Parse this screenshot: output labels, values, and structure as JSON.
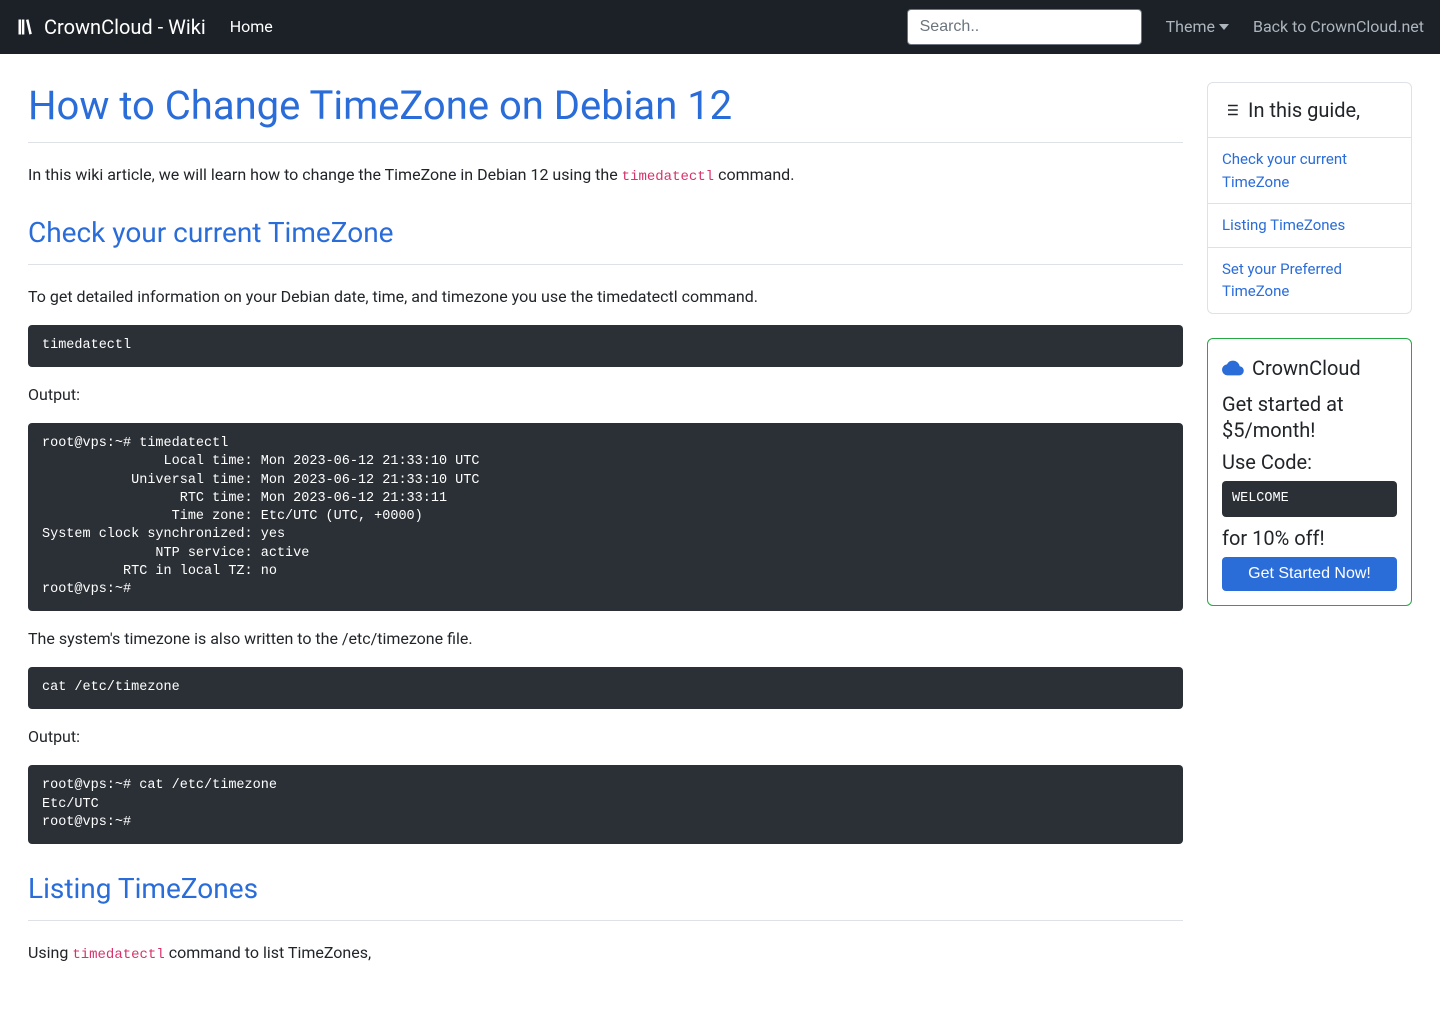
{
  "nav": {
    "brand": "CrownCloud - Wiki",
    "home": "Home",
    "search_placeholder": "Search..",
    "theme": "Theme",
    "back_link": "Back to CrownCloud.net"
  },
  "page": {
    "title": "How to Change TimeZone on Debian 12",
    "intro_before": "In this wiki article, we will learn how to change the TimeZone in Debian 12 using the ",
    "intro_code": "timedatectl",
    "intro_after": " command.",
    "section1_title": "Check your current TimeZone",
    "section1_p1": "To get detailed information on your Debian date, time, and timezone you use the timedatectl command.",
    "section1_code1": "timedatectl",
    "output_label": "Output:",
    "section1_code2": "root@vps:~# timedatectl\n               Local time: Mon 2023-06-12 21:33:10 UTC\n           Universal time: Mon 2023-06-12 21:33:10 UTC\n                 RTC time: Mon 2023-06-12 21:33:11\n                Time zone: Etc/UTC (UTC, +0000)\nSystem clock synchronized: yes\n              NTP service: active\n          RTC in local TZ: no\nroot@vps:~#",
    "section1_p2": "The system's timezone is also written to the /etc/timezone file.",
    "section1_code3": "cat /etc/timezone",
    "section1_code4": "root@vps:~# cat /etc/timezone\nEtc/UTC\nroot@vps:~#",
    "section2_title": "Listing TimeZones",
    "section2_p1_before": "Using ",
    "section2_p1_code": "timedatectl",
    "section2_p1_after": " command to list TimeZones,"
  },
  "toc": {
    "title": "In this guide,",
    "items": [
      "Check your current TimeZone",
      "Listing TimeZones",
      "Set your Preferred TimeZone"
    ]
  },
  "promo": {
    "title": "CrownCloud",
    "line1": "Get started at $5/month!",
    "line2": "Use Code:",
    "code": "WELCOME",
    "line3": "for 10% off!",
    "button": "Get Started Now!"
  }
}
